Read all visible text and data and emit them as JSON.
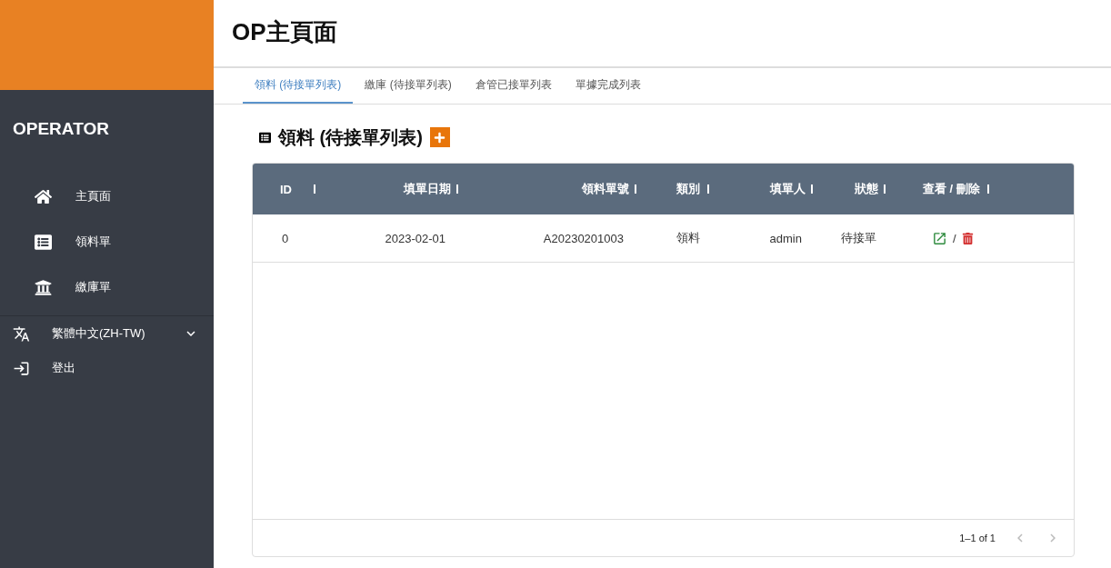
{
  "sidebar": {
    "brand": "OPERATOR",
    "items": [
      {
        "kind": "home",
        "label": "主頁面"
      },
      {
        "kind": "list",
        "label": "領料單"
      },
      {
        "kind": "bank",
        "label": "繳庫單"
      }
    ],
    "language": {
      "label": "繁體中文(ZH-TW)",
      "expanded": false
    },
    "logout": {
      "label": "登出"
    }
  },
  "page": {
    "title": "OP主頁面"
  },
  "tabs": [
    {
      "label": "領料 (待接單列表)",
      "selected": true
    },
    {
      "label": "繳庫 (待接單列表)",
      "selected": false
    },
    {
      "label": "倉管已接單列表",
      "selected": false
    },
    {
      "label": "單據完成列表",
      "selected": false
    }
  ],
  "section": {
    "title": "領料 (待接單列表)"
  },
  "table": {
    "columns": [
      "ID",
      "填單日期",
      "領料單號",
      "類別",
      "填單人",
      "狀態",
      "查看 / 刪除"
    ],
    "rows": [
      {
        "id": "0",
        "date": "2023-02-01",
        "number": "A20230201003",
        "type": "領料",
        "by": "admin",
        "status": "待接單",
        "separator": "/"
      }
    ]
  },
  "pagination": {
    "range": "1–1 of 1"
  }
}
